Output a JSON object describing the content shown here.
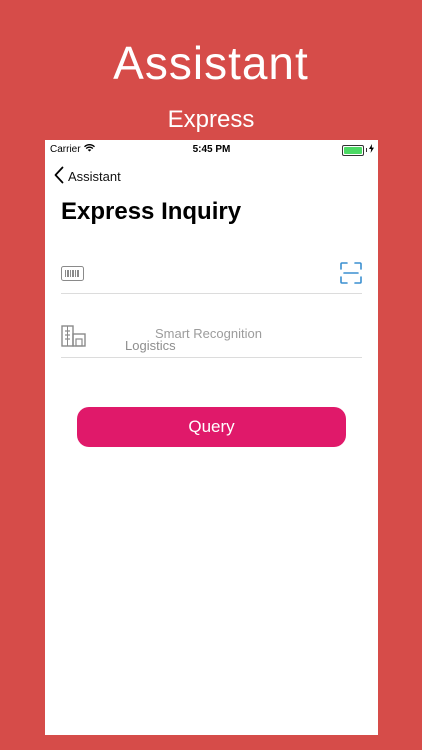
{
  "promo": {
    "title": "Assistant",
    "subtitle": "Express"
  },
  "status_bar": {
    "carrier": "Carrier",
    "time": "5:45 PM",
    "battery_level": 1.0
  },
  "nav": {
    "back_label": "Assistant"
  },
  "page": {
    "title": "Express Inquiry"
  },
  "tracking_field": {
    "value": "",
    "placeholder": ""
  },
  "logistics_field": {
    "label": "Logistics",
    "smart_label": "Smart Recognition"
  },
  "query_button": {
    "label": "Query"
  },
  "colors": {
    "background": "#d64c49",
    "accent": "#e0196a",
    "scan_icon": "#3a8fd0",
    "battery": "#4cd964"
  },
  "icons": {
    "back": "chevron-left-icon",
    "wifi": "wifi-icon",
    "battery": "battery-icon",
    "charging": "bolt-icon",
    "barcode": "barcode-icon",
    "scan": "scan-icon",
    "company": "building-icon"
  }
}
